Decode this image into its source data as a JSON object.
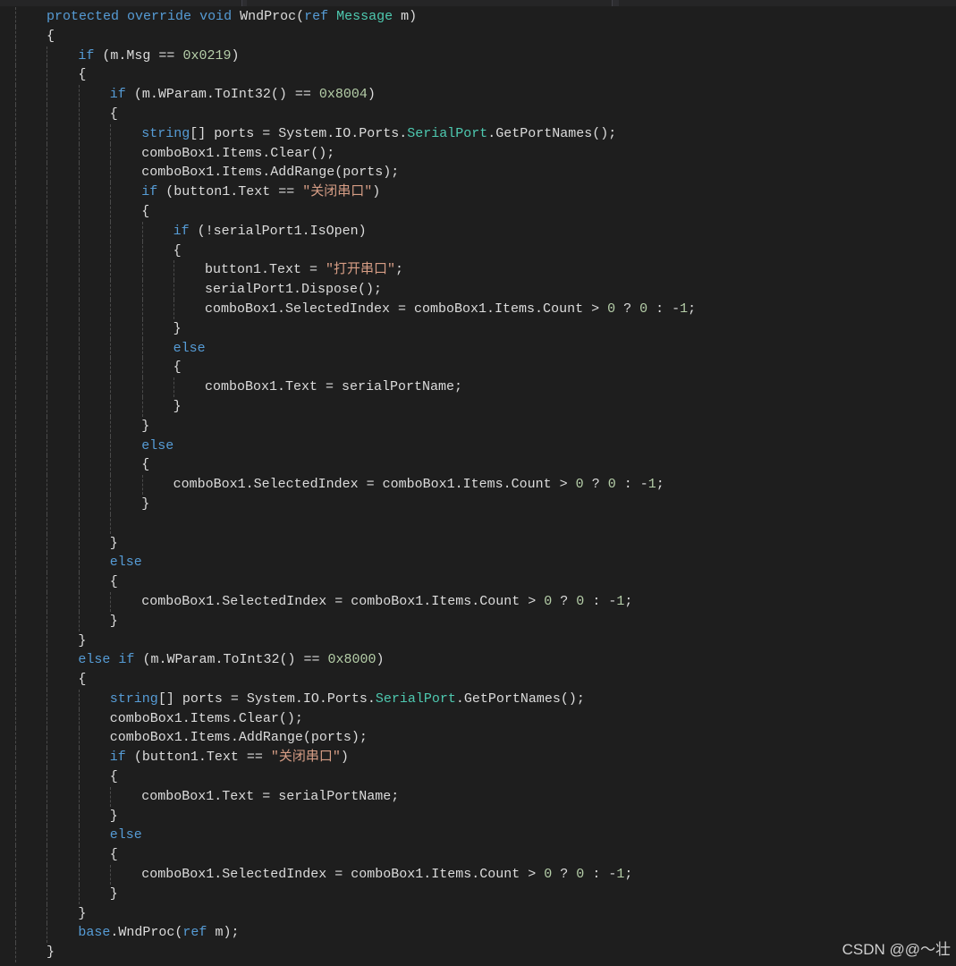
{
  "editor": {
    "theme": "dark",
    "background": "#1e1e1e",
    "colors": {
      "text": "#dcdcdc",
      "keyword": "#569cd6",
      "type": "#4ec9b0",
      "number": "#b5cea8",
      "string": "#d69d85",
      "indent_guide": "#4a4a4a"
    },
    "lines": [
      {
        "indent": 1,
        "tokens": [
          [
            "protected",
            "kw"
          ],
          [
            " ",
            ""
          ],
          [
            "override",
            "kw"
          ],
          [
            " ",
            ""
          ],
          [
            "void",
            "kw"
          ],
          [
            " WndProc(",
            ""
          ],
          [
            "ref",
            "kw"
          ],
          [
            " ",
            ""
          ],
          [
            "Message",
            "ty"
          ],
          [
            " m)",
            ""
          ]
        ]
      },
      {
        "indent": 1,
        "tokens": [
          [
            "{",
            ""
          ]
        ]
      },
      {
        "indent": 2,
        "tokens": [
          [
            "if",
            "kw"
          ],
          [
            " (m.Msg == ",
            ""
          ],
          [
            "0x0219",
            "num"
          ],
          [
            ")",
            ""
          ]
        ]
      },
      {
        "indent": 2,
        "tokens": [
          [
            "{",
            ""
          ]
        ]
      },
      {
        "indent": 3,
        "tokens": [
          [
            "if",
            "kw"
          ],
          [
            " (m.WParam.ToInt32() == ",
            ""
          ],
          [
            "0x8004",
            "num"
          ],
          [
            ")",
            ""
          ]
        ]
      },
      {
        "indent": 3,
        "tokens": [
          [
            "{",
            ""
          ]
        ]
      },
      {
        "indent": 4,
        "tokens": [
          [
            "string",
            "kw"
          ],
          [
            "[] ports = System.IO.Ports.",
            ""
          ],
          [
            "SerialPort",
            "ty"
          ],
          [
            ".GetPortNames();",
            ""
          ]
        ]
      },
      {
        "indent": 4,
        "tokens": [
          [
            "comboBox1.Items.Clear();",
            ""
          ]
        ]
      },
      {
        "indent": 4,
        "tokens": [
          [
            "comboBox1.Items.AddRange(ports);",
            ""
          ]
        ]
      },
      {
        "indent": 4,
        "tokens": [
          [
            "if",
            "kw"
          ],
          [
            " (button1.Text == ",
            ""
          ],
          [
            "\"关闭串口\"",
            "str"
          ],
          [
            ")",
            ""
          ]
        ]
      },
      {
        "indent": 4,
        "tokens": [
          [
            "{",
            ""
          ]
        ]
      },
      {
        "indent": 5,
        "tokens": [
          [
            "if",
            "kw"
          ],
          [
            " (!serialPort1.IsOpen)",
            ""
          ]
        ]
      },
      {
        "indent": 5,
        "tokens": [
          [
            "{",
            ""
          ]
        ]
      },
      {
        "indent": 6,
        "tokens": [
          [
            "button1.Text = ",
            ""
          ],
          [
            "\"打开串口\"",
            "str"
          ],
          [
            ";",
            ""
          ]
        ]
      },
      {
        "indent": 6,
        "tokens": [
          [
            "serialPort1.Dispose();",
            ""
          ]
        ]
      },
      {
        "indent": 6,
        "tokens": [
          [
            "comboBox1.SelectedIndex = comboBox1.Items.Count > ",
            ""
          ],
          [
            "0",
            "num"
          ],
          [
            " ? ",
            ""
          ],
          [
            "0",
            "num"
          ],
          [
            " : -",
            ""
          ],
          [
            "1",
            "num"
          ],
          [
            ";",
            ""
          ]
        ]
      },
      {
        "indent": 5,
        "tokens": [
          [
            "}",
            ""
          ]
        ]
      },
      {
        "indent": 5,
        "tokens": [
          [
            "else",
            "kw"
          ]
        ]
      },
      {
        "indent": 5,
        "tokens": [
          [
            "{",
            ""
          ]
        ]
      },
      {
        "indent": 6,
        "tokens": [
          [
            "comboBox1.Text = serialPortName;",
            ""
          ]
        ]
      },
      {
        "indent": 5,
        "tokens": [
          [
            "}",
            ""
          ]
        ]
      },
      {
        "indent": 4,
        "tokens": [
          [
            "}",
            ""
          ]
        ]
      },
      {
        "indent": 4,
        "tokens": [
          [
            "else",
            "kw"
          ]
        ]
      },
      {
        "indent": 4,
        "tokens": [
          [
            "{",
            ""
          ]
        ]
      },
      {
        "indent": 5,
        "tokens": [
          [
            "comboBox1.SelectedIndex = comboBox1.Items.Count > ",
            ""
          ],
          [
            "0",
            "num"
          ],
          [
            " ? ",
            ""
          ],
          [
            "0",
            "num"
          ],
          [
            " : -",
            ""
          ],
          [
            "1",
            "num"
          ],
          [
            ";",
            ""
          ]
        ]
      },
      {
        "indent": 4,
        "tokens": [
          [
            "}",
            ""
          ]
        ]
      },
      {
        "indent": 4,
        "tokens": []
      },
      {
        "indent": 3,
        "tokens": [
          [
            "}",
            ""
          ]
        ]
      },
      {
        "indent": 3,
        "tokens": [
          [
            "else",
            "kw"
          ]
        ]
      },
      {
        "indent": 3,
        "tokens": [
          [
            "{",
            ""
          ]
        ]
      },
      {
        "indent": 4,
        "tokens": [
          [
            "comboBox1.SelectedIndex = comboBox1.Items.Count > ",
            ""
          ],
          [
            "0",
            "num"
          ],
          [
            " ? ",
            ""
          ],
          [
            "0",
            "num"
          ],
          [
            " : -",
            ""
          ],
          [
            "1",
            "num"
          ],
          [
            ";",
            ""
          ]
        ]
      },
      {
        "indent": 3,
        "tokens": [
          [
            "}",
            ""
          ]
        ]
      },
      {
        "indent": 2,
        "tokens": [
          [
            "}",
            ""
          ]
        ]
      },
      {
        "indent": 2,
        "tokens": [
          [
            "else",
            "kw"
          ],
          [
            " ",
            ""
          ],
          [
            "if",
            "kw"
          ],
          [
            " (m.WParam.ToInt32() == ",
            ""
          ],
          [
            "0x8000",
            "num"
          ],
          [
            ")",
            ""
          ]
        ]
      },
      {
        "indent": 2,
        "tokens": [
          [
            "{",
            ""
          ]
        ]
      },
      {
        "indent": 3,
        "tokens": [
          [
            "string",
            "kw"
          ],
          [
            "[] ports = System.IO.Ports.",
            ""
          ],
          [
            "SerialPort",
            "ty"
          ],
          [
            ".GetPortNames();",
            ""
          ]
        ]
      },
      {
        "indent": 3,
        "tokens": [
          [
            "comboBox1.Items.Clear();",
            ""
          ]
        ]
      },
      {
        "indent": 3,
        "tokens": [
          [
            "comboBox1.Items.AddRange(ports);",
            ""
          ]
        ]
      },
      {
        "indent": 3,
        "tokens": [
          [
            "if",
            "kw"
          ],
          [
            " (button1.Text == ",
            ""
          ],
          [
            "\"关闭串口\"",
            "str"
          ],
          [
            ")",
            ""
          ]
        ]
      },
      {
        "indent": 3,
        "tokens": [
          [
            "{",
            ""
          ]
        ]
      },
      {
        "indent": 4,
        "tokens": [
          [
            "comboBox1.Text = serialPortName;",
            ""
          ]
        ]
      },
      {
        "indent": 3,
        "tokens": [
          [
            "}",
            ""
          ]
        ]
      },
      {
        "indent": 3,
        "tokens": [
          [
            "else",
            "kw"
          ]
        ]
      },
      {
        "indent": 3,
        "tokens": [
          [
            "{",
            ""
          ]
        ]
      },
      {
        "indent": 4,
        "tokens": [
          [
            "comboBox1.SelectedIndex = comboBox1.Items.Count > ",
            ""
          ],
          [
            "0",
            "num"
          ],
          [
            " ? ",
            ""
          ],
          [
            "0",
            "num"
          ],
          [
            " : -",
            ""
          ],
          [
            "1",
            "num"
          ],
          [
            ";",
            ""
          ]
        ]
      },
      {
        "indent": 3,
        "tokens": [
          [
            "}",
            ""
          ]
        ]
      },
      {
        "indent": 2,
        "tokens": [
          [
            "}",
            ""
          ]
        ]
      },
      {
        "indent": 2,
        "tokens": [
          [
            "base",
            "kw"
          ],
          [
            ".WndProc(",
            ""
          ],
          [
            "ref",
            "kw"
          ],
          [
            " m);",
            ""
          ]
        ]
      },
      {
        "indent": 1,
        "tokens": [
          [
            "}",
            ""
          ]
        ]
      }
    ]
  },
  "watermark": "CSDN @@～壮"
}
